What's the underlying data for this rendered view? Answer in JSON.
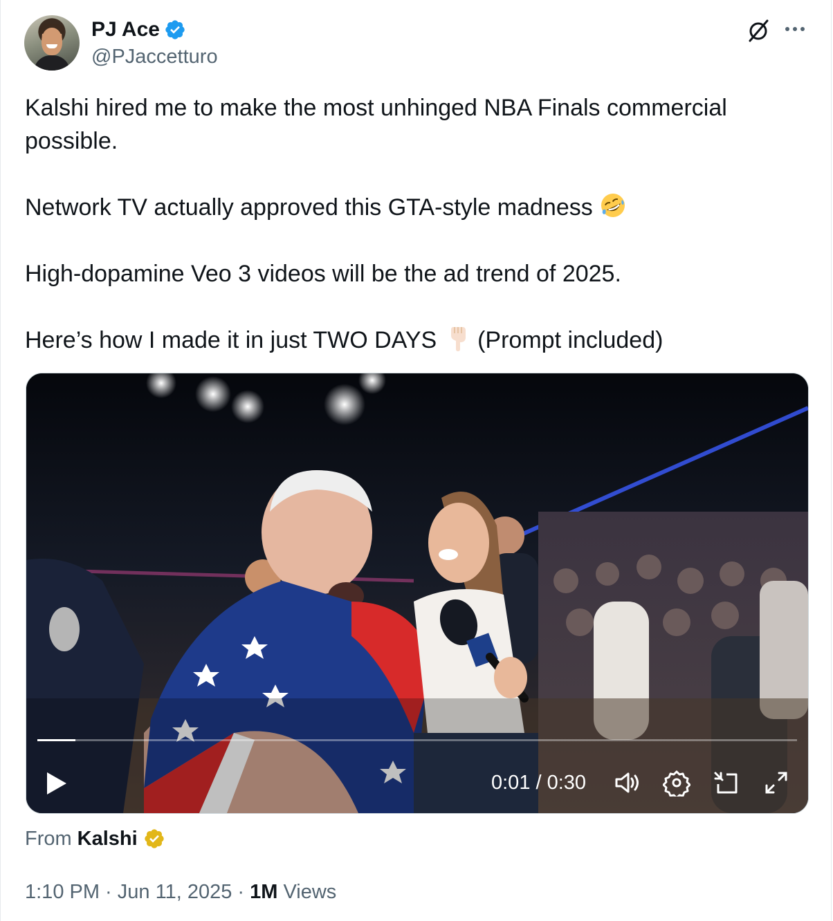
{
  "author": {
    "display_name": "PJ Ace",
    "handle": "@PJaccetturo"
  },
  "tweet": {
    "paragraphs": [
      "Kalshi hired me to make the most unhinged NBA Finals commercial possible.",
      "Network TV actually approved this GTA-style madness",
      "High-dopamine Veo 3 videos will be the ad trend of 2025.",
      "Here’s how I made it in just TWO DAYS"
    ],
    "p2_emoji": "rolling-on-floor-laughing-emoji",
    "p4_emoji": "backhand-index-pointing-down-emoji",
    "p4_suffix": " (Prompt included)"
  },
  "video": {
    "time_display": "0:01 / 0:30",
    "progress_fraction": 0.05,
    "controls": [
      "play-icon",
      "volume-icon",
      "settings-icon",
      "picture-in-picture-icon",
      "fullscreen-icon"
    ]
  },
  "attribution": {
    "prefix": "From",
    "name": "Kalshi",
    "badge_color": "#e2b719"
  },
  "meta": {
    "time": "1:10 PM",
    "separator": " · ",
    "date": "Jun 11, 2025",
    "views_count": "1M",
    "views_label": " Views"
  },
  "colors": {
    "verified_blue": "#1d9bf0",
    "secondary_text": "#536471",
    "primary_text": "#0f1419"
  }
}
